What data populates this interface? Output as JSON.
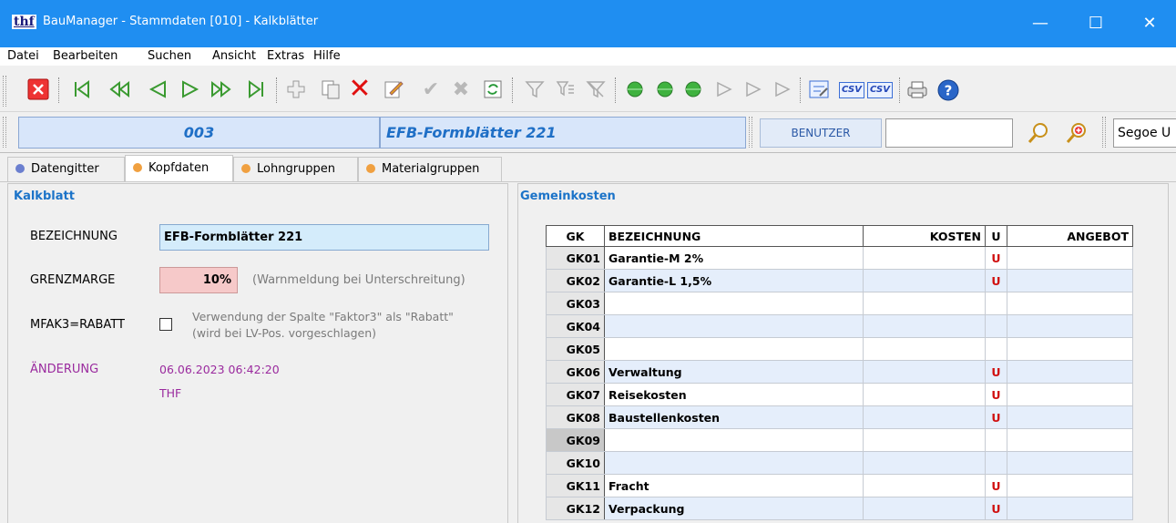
{
  "window": {
    "app_icon": "thf",
    "title": "BauManager - Stammdaten [010] - Kalkblätter",
    "controls": [
      "—",
      "☐",
      "✕"
    ]
  },
  "menu": [
    "Datei",
    "Bearbeiten",
    "Suchen",
    "Ansicht",
    "Extras",
    "Hilfe"
  ],
  "toolbar": {
    "icons": [
      "close-icon",
      "first-record-icon",
      "fast-back-icon",
      "prev-icon",
      "next-icon",
      "fast-forward-icon",
      "last-record-icon",
      "add-icon",
      "copy-icon",
      "delete-icon",
      "edit-icon",
      "confirm-icon",
      "cancel-icon",
      "refresh-icon",
      "filter-icon",
      "filter-edit-icon",
      "filter-clear-icon",
      "green-dot-1",
      "green-dot-2",
      "green-dot-3",
      "play-outline-1",
      "play-outline-2",
      "play-outline-3",
      "settings-icon",
      "csv-export-icon",
      "csv-import-icon",
      "print-icon",
      "help-icon"
    ],
    "csv1": "CSV",
    "csv2": "CSV"
  },
  "record": {
    "number": "003",
    "name": "EFB-Formblätter 221",
    "benutzer_button": "BENUTZER",
    "user_value": "",
    "font_value": "Segoe U"
  },
  "tabs": [
    {
      "label": "Datengitter",
      "color": "#6b7fcf"
    },
    {
      "label": "Kopfdaten",
      "color": "#f0a040"
    },
    {
      "label": "Lohngruppen",
      "color": "#f0a040"
    },
    {
      "label": "Materialgruppen",
      "color": "#f0a040"
    }
  ],
  "kalkblatt": {
    "title": "Kalkblatt",
    "bezeichnung_label": "BEZEICHNUNG",
    "bezeichnung_value": "EFB-Formblätter 221",
    "grenzmarge_label": "GRENZMARGE",
    "grenzmarge_value": "10%",
    "grenzmarge_hint": "(Warnmeldung bei Unterschreitung)",
    "mfak_label": "MFAK3=RABATT",
    "mfak_checked": false,
    "mfak_hint_1": "Verwendung der Spalte \"Faktor3\" als \"Rabatt\"",
    "mfak_hint_2": "(wird bei LV-Pos. vorgeschlagen)",
    "aenderung_label": "ÄNDERUNG",
    "aenderung_date": "06.06.2023 06:42:20",
    "aenderung_user": "THF"
  },
  "gemeinkosten": {
    "title": "Gemeinkosten",
    "headers": [
      "GK",
      "BEZEICHNUNG",
      "KOSTEN",
      "U",
      "ANGEBOT"
    ],
    "rows": [
      {
        "gk": "GK01",
        "bez": "Garantie-M 2%",
        "kosten": "",
        "u": "U",
        "angebot": ""
      },
      {
        "gk": "GK02",
        "bez": "Garantie-L 1,5%",
        "kosten": "",
        "u": "U",
        "angebot": ""
      },
      {
        "gk": "GK03",
        "bez": "",
        "kosten": "",
        "u": "",
        "angebot": ""
      },
      {
        "gk": "GK04",
        "bez": "",
        "kosten": "",
        "u": "",
        "angebot": ""
      },
      {
        "gk": "GK05",
        "bez": "",
        "kosten": "",
        "u": "",
        "angebot": ""
      },
      {
        "gk": "GK06",
        "bez": "Verwaltung",
        "kosten": "",
        "u": "U",
        "angebot": ""
      },
      {
        "gk": "GK07",
        "bez": "Reisekosten",
        "kosten": "",
        "u": "U",
        "angebot": ""
      },
      {
        "gk": "GK08",
        "bez": "Baustellenkosten",
        "kosten": "",
        "u": "U",
        "angebot": ""
      },
      {
        "gk": "GK09",
        "bez": "",
        "kosten": "",
        "u": "",
        "angebot": ""
      },
      {
        "gk": "GK10",
        "bez": "",
        "kosten": "",
        "u": "",
        "angebot": ""
      },
      {
        "gk": "GK11",
        "bez": "Fracht",
        "kosten": "",
        "u": "U",
        "angebot": ""
      },
      {
        "gk": "GK12",
        "bez": "Verpackung",
        "kosten": "",
        "u": "U",
        "angebot": ""
      }
    ]
  }
}
